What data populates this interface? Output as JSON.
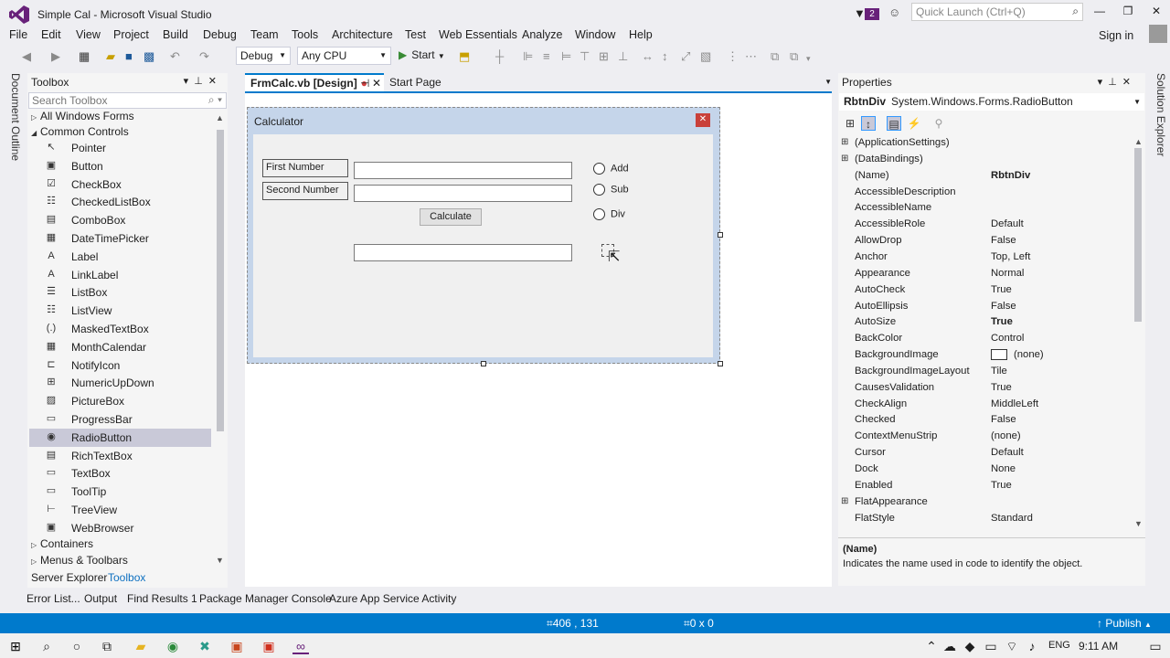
{
  "window": {
    "title": "Simple Cal - Microsoft Visual Studio",
    "notifications": "2",
    "quick_launch_placeholder": "Quick Launch (Ctrl+Q)"
  },
  "menu": [
    "File",
    "Edit",
    "View",
    "Project",
    "Build",
    "Debug",
    "Team",
    "Tools",
    "Architecture",
    "Test",
    "Web Essentials",
    "Analyze",
    "Window",
    "Help"
  ],
  "signin": "Sign in",
  "toolbar": {
    "config": "Debug",
    "platform": "Any CPU",
    "start": "Start"
  },
  "side_tabs": {
    "left": "Document Outline",
    "right": "Solution Explorer"
  },
  "toolbox": {
    "title": "Toolbox",
    "search_placeholder": "Search Toolbox",
    "categories": [
      "All Windows Forms",
      "Common Controls",
      "Containers",
      "Menus & Toolbars"
    ],
    "items": [
      {
        "label": "Pointer",
        "icon": "pointer-icon",
        "glyph": "↖"
      },
      {
        "label": "Button",
        "icon": "button-icon",
        "glyph": "▣"
      },
      {
        "label": "CheckBox",
        "icon": "checkbox-icon",
        "glyph": "☑"
      },
      {
        "label": "CheckedListBox",
        "icon": "checkedlistbox-icon",
        "glyph": "☷"
      },
      {
        "label": "ComboBox",
        "icon": "combobox-icon",
        "glyph": "▤"
      },
      {
        "label": "DateTimePicker",
        "icon": "datetimepicker-icon",
        "glyph": "▦"
      },
      {
        "label": "Label",
        "icon": "label-icon",
        "glyph": "A"
      },
      {
        "label": "LinkLabel",
        "icon": "linklabel-icon",
        "glyph": "A"
      },
      {
        "label": "ListBox",
        "icon": "listbox-icon",
        "glyph": "☰"
      },
      {
        "label": "ListView",
        "icon": "listview-icon",
        "glyph": "☷"
      },
      {
        "label": "MaskedTextBox",
        "icon": "maskedtextbox-icon",
        "glyph": "(.)"
      },
      {
        "label": "MonthCalendar",
        "icon": "monthcalendar-icon",
        "glyph": "▦"
      },
      {
        "label": "NotifyIcon",
        "icon": "notifyicon-icon",
        "glyph": "⊏"
      },
      {
        "label": "NumericUpDown",
        "icon": "numericupdown-icon",
        "glyph": "⊞"
      },
      {
        "label": "PictureBox",
        "icon": "picturebox-icon",
        "glyph": "▨"
      },
      {
        "label": "ProgressBar",
        "icon": "progressbar-icon",
        "glyph": "▭"
      },
      {
        "label": "RadioButton",
        "icon": "radiobutton-icon",
        "glyph": "◉"
      },
      {
        "label": "RichTextBox",
        "icon": "richtextbox-icon",
        "glyph": "▤"
      },
      {
        "label": "TextBox",
        "icon": "textbox-icon",
        "glyph": "▭"
      },
      {
        "label": "ToolTip",
        "icon": "tooltip-icon",
        "glyph": "▭"
      },
      {
        "label": "TreeView",
        "icon": "treeview-icon",
        "glyph": "⊢"
      },
      {
        "label": "WebBrowser",
        "icon": "webbrowser-icon",
        "glyph": "▣"
      }
    ],
    "selected": "RadioButton",
    "bottom_tabs": [
      "Server Explorer",
      "Toolbox"
    ]
  },
  "editor": {
    "tabs": [
      {
        "label": "FrmCalc.vb [Design]",
        "modified": true
      },
      {
        "label": "Start Page"
      }
    ],
    "form": {
      "title": "Calculator",
      "labels": [
        "First Number",
        "Second Number"
      ],
      "button": "Calculate",
      "radios": [
        "Add",
        "Sub",
        "Div"
      ]
    }
  },
  "properties": {
    "title": "Properties",
    "object_name": "RbtnDiv",
    "object_type": "System.Windows.Forms.RadioButton",
    "rows": [
      {
        "name": "(ApplicationSettings)",
        "value": "",
        "expandable": true
      },
      {
        "name": "(DataBindings)",
        "value": "",
        "expandable": true
      },
      {
        "name": "(Name)",
        "value": "RbtnDiv",
        "bold": true,
        "selected": true
      },
      {
        "name": "AccessibleDescription",
        "value": ""
      },
      {
        "name": "AccessibleName",
        "value": ""
      },
      {
        "name": "AccessibleRole",
        "value": "Default"
      },
      {
        "name": "AllowDrop",
        "value": "False"
      },
      {
        "name": "Anchor",
        "value": "Top, Left"
      },
      {
        "name": "Appearance",
        "value": "Normal"
      },
      {
        "name": "AutoCheck",
        "value": "True"
      },
      {
        "name": "AutoEllipsis",
        "value": "False"
      },
      {
        "name": "AutoSize",
        "value": "True",
        "bold": true
      },
      {
        "name": "BackColor",
        "value": "Control"
      },
      {
        "name": "BackgroundImage",
        "value": "(none)",
        "swatch": true
      },
      {
        "name": "BackgroundImageLayout",
        "value": "Tile"
      },
      {
        "name": "CausesValidation",
        "value": "True"
      },
      {
        "name": "CheckAlign",
        "value": "MiddleLeft"
      },
      {
        "name": "Checked",
        "value": "False"
      },
      {
        "name": "ContextMenuStrip",
        "value": "(none)"
      },
      {
        "name": "Cursor",
        "value": "Default"
      },
      {
        "name": "Dock",
        "value": "None"
      },
      {
        "name": "Enabled",
        "value": "True"
      },
      {
        "name": "FlatAppearance",
        "value": "",
        "expandable": true
      },
      {
        "name": "FlatStyle",
        "value": "Standard"
      }
    ],
    "description_title": "(Name)",
    "description": "Indicates the name used in code to identify the object."
  },
  "output_tabs": [
    "Error List...",
    "Output",
    "Find Results 1",
    "Package Manager Console",
    "Azure App Service Activity"
  ],
  "status": {
    "position": "406 , 131",
    "size": "0 x 0",
    "publish": "Publish"
  },
  "taskbar": {
    "lang": "ENG",
    "time": "9:11 AM"
  },
  "colors": {
    "accent": "#007acc",
    "vs_purple": "#68217a",
    "selection": "#c9c9d8"
  }
}
